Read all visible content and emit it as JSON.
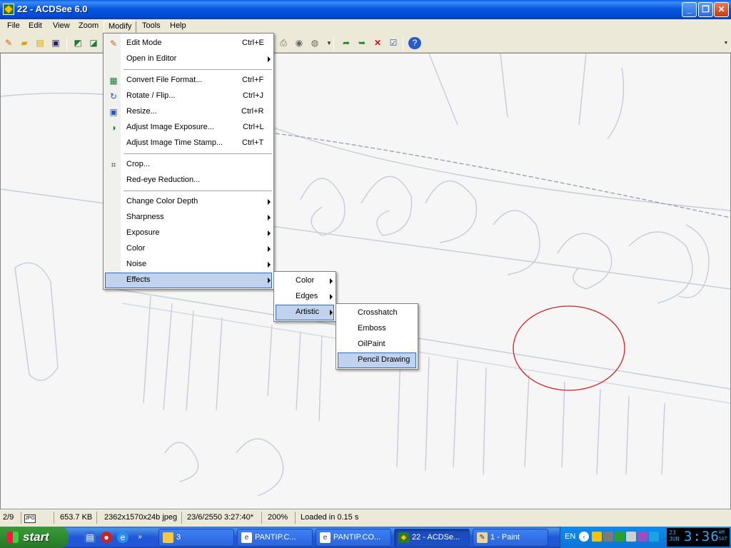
{
  "window": {
    "title": "22 - ACDSee 6.0",
    "minimize": "_",
    "maximize": "❐",
    "close": "✕"
  },
  "menubar": [
    "File",
    "Edit",
    "View",
    "Zoom",
    "Modify",
    "Tools",
    "Help"
  ],
  "modify_menu": {
    "items": [
      {
        "label": "Edit Mode",
        "shortcut": "Ctrl+E",
        "icon": "edit-mode-icon"
      },
      {
        "label": "Open in Editor",
        "submenu": true
      },
      {
        "label": "Convert File Format...",
        "shortcut": "Ctrl+F",
        "icon": "convert-icon"
      },
      {
        "label": "Rotate / Flip...",
        "shortcut": "Ctrl+J",
        "icon": "rotate-icon"
      },
      {
        "label": "Resize...",
        "shortcut": "Ctrl+R",
        "icon": "resize-icon"
      },
      {
        "label": "Adjust Image Exposure...",
        "shortcut": "Ctrl+L",
        "icon": "exposure-icon"
      },
      {
        "label": "Adjust Image Time Stamp...",
        "shortcut": "Ctrl+T"
      },
      {
        "label": "Crop...",
        "icon": "crop-icon"
      },
      {
        "label": "Red-eye Reduction..."
      },
      {
        "label": "Change Color Depth",
        "submenu": true
      },
      {
        "label": "Sharpness",
        "submenu": true
      },
      {
        "label": "Exposure",
        "submenu": true
      },
      {
        "label": "Color",
        "submenu": true
      },
      {
        "label": "Noise",
        "submenu": true
      },
      {
        "label": "Effects",
        "submenu": true,
        "highlighted": true
      }
    ]
  },
  "effects_menu": {
    "items": [
      "Color",
      "Edges",
      "Artistic"
    ],
    "highlighted": "Artistic"
  },
  "artistic_menu": {
    "items": [
      "Crosshatch",
      "Emboss",
      "OilPaint",
      "Pencil Drawing"
    ],
    "highlighted": "Pencil Drawing"
  },
  "statusbar": {
    "position": "2/9",
    "size": "653.7 KB",
    "dimensions": "2362x1570x24b jpeg",
    "datetime": "23/6/2550 3:27:40*",
    "zoom": "200%",
    "load": "Loaded in 0.15 s"
  },
  "taskbar": {
    "start": "start",
    "tasks": [
      {
        "label": "3",
        "icon": "folder-icon"
      },
      {
        "label": "PANTIP.C...",
        "icon": "browser-icon"
      },
      {
        "label": "PANTIP.CO...",
        "icon": "browser-icon"
      },
      {
        "label": "22 - ACDSe...",
        "icon": "acdsee-icon",
        "active": true
      },
      {
        "label": "1 - Paint",
        "icon": "paint-icon"
      }
    ],
    "language": "EN",
    "clock": {
      "time": "3:36",
      "date_line1": "23",
      "date_line2": "JUN",
      "ampm1": "AM",
      "ampm2": "SAT"
    }
  },
  "colors": {
    "highlight_bg": "#C1D2EE",
    "highlight_border": "#316AC5",
    "annotation_circle": "#D62020"
  }
}
